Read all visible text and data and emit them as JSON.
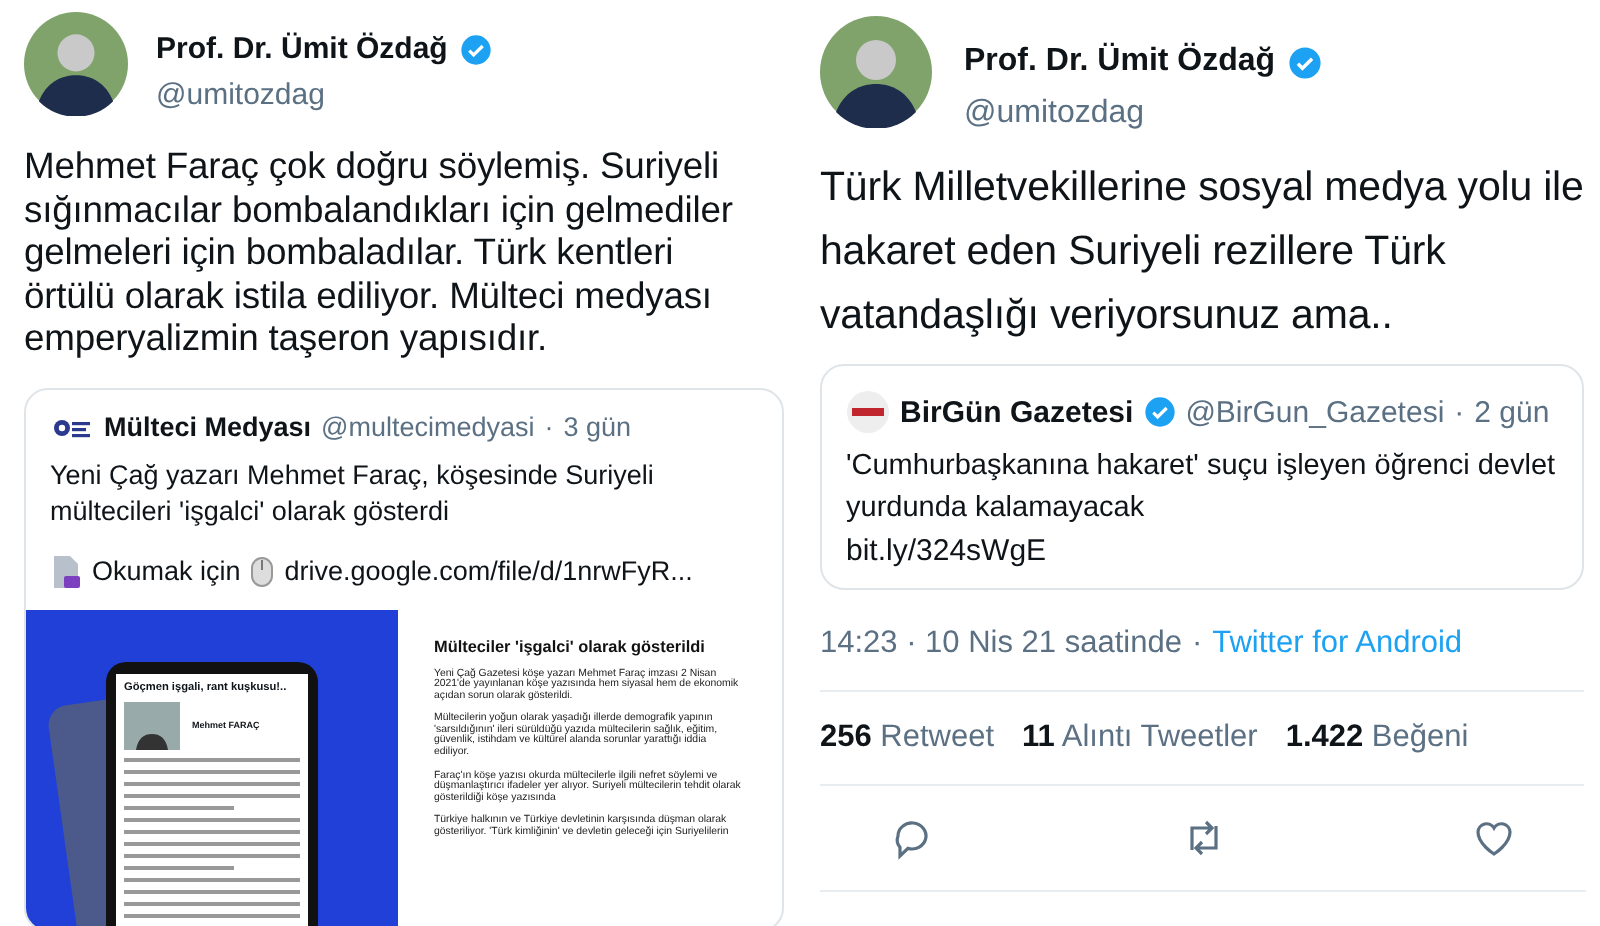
{
  "tweets": [
    {
      "author": {
        "name": "Prof. Dr. Ümit Özdağ",
        "handle": "@umitozdag",
        "verified": true
      },
      "text": "Mehmet Faraç çok doğru söylemiş. Suriyeli sığınmacılar bombalandıkları için gelmediler gelmeleri için bombaladılar. Türk kentleri örtülü olarak istila ediliyor. Mülteci medyası emperyalizmin taşeron yapısıdır.",
      "quote": {
        "author": "Mülteci Medyası",
        "verified": false,
        "handle": "@multecimedyasi",
        "separator": "·",
        "time": "3 gün",
        "text": "Yeni Çağ yazarı Mehmet Faraç, köşesinde Suriyeli mültecileri 'işgalci' olarak gösterdi",
        "link_label": "Okumak için",
        "link": "drive.google.com/file/d/1nrwFyR...",
        "media": {
          "tablet_title": "Göçmen işgali, rant kuşkusu!..",
          "tablet_author": "Mehmet FARAÇ",
          "headline": "Mülteciler 'işgalci' olarak gösterildi",
          "paragraphs": [
            "Yeni Çağ Gazetesi köşe yazarı Mehmet Faraç imzası 2 Nisan 2021'de yayınlanan köşe yazısında hem siyasal hem de ekonomik açıdan sorun olarak gösterildi.",
            "Mültecilerin yoğun olarak yaşadığı illerde demografik yapının 'sarsıldığının' ileri sürüldüğü yazıda mültecilerin sağlık, eğitim, güvenlik, istihdam ve kültürel alanda sorunlar yarattığı iddia ediliyor.",
            "Faraç'ın köşe yazısı okurda mültecilerle ilgili nefret söylemi ve düşmanlaştırıcı ifadeler yer alıyor. Suriyeli mültecilerin tehdit olarak gösterildiği köşe yazısında",
            "Türkiye halkının ve Türkiye devletinin karşısında düşman olarak gösteriliyor. 'Türk kimliğinin' ve devletin geleceği için Suriyelilerin"
          ]
        }
      }
    },
    {
      "author": {
        "name": "Prof. Dr. Ümit Özdağ",
        "handle": "@umitozdag",
        "verified": true
      },
      "text": "Türk Milletvekillerine sosyal medya yolu ile hakaret eden Suriyeli rezillere Türk vatandaşlığı veriyorsunuz ama..",
      "quote": {
        "author": "BirGün Gazetesi",
        "verified": true,
        "handle": "@BirGun_Gazetesi",
        "separator": "·",
        "time": "2 gün",
        "text": "'Cumhurbaşkanına hakaret' suçu işleyen öğrenci devlet yurdunda kalamayacak",
        "link": "bit.ly/324sWgE"
      },
      "meta": {
        "time": "14:23 · 10 Nis 21 saatinde",
        "separator": "·",
        "source": "Twitter for Android"
      },
      "stats": [
        {
          "count": "256",
          "label": "Retweet"
        },
        {
          "count": "11",
          "label": "Alıntı Tweetler"
        },
        {
          "count": "1.422",
          "label": "Beğeni"
        }
      ],
      "actions": [
        {
          "kind": "reply"
        },
        {
          "kind": "retweet"
        },
        {
          "kind": "like"
        }
      ]
    }
  ]
}
